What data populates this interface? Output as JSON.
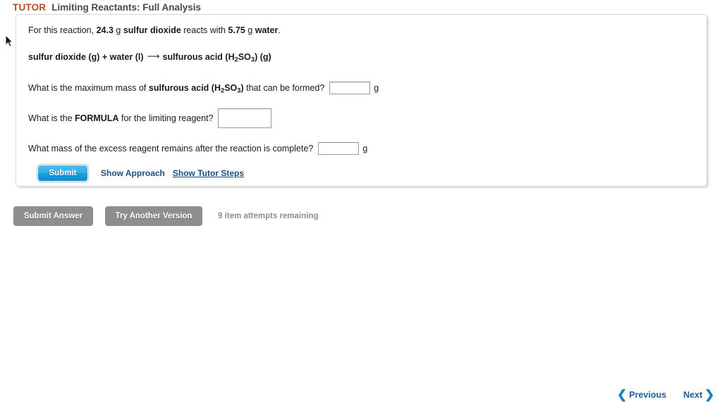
{
  "header": {
    "tutor_label": "TUTOR",
    "title": "Limiting Reactants: Full Analysis"
  },
  "question": {
    "prompt_prefix": "For this reaction, ",
    "mass_1": "24.3",
    "unit_1": " g ",
    "reactant_1": "sulfur dioxide",
    "connector": " reacts with ",
    "mass_2": "5.75",
    "unit_2": " g ",
    "reactant_2": "water",
    "period": ".",
    "equation": {
      "reactant_a": "sulfur dioxide",
      "state_a": " (g)",
      "plus": " + ",
      "reactant_b": "water",
      "state_b": " (l)",
      "arrow": "⟶",
      "product": "sulfurous acid (H",
      "product_sub1": "2",
      "product_mid": "SO",
      "product_sub2": "3",
      "product_close": ")",
      "state_c": " (g)"
    },
    "q1_pre": "What is the maximum mass of ",
    "q1_bold_a": "sulfurous acid (H",
    "q1_sub1": "2",
    "q1_bold_b": "SO",
    "q1_sub2": "3",
    "q1_bold_c": ")",
    "q1_post": " that can be formed?",
    "q1_value": "",
    "q1_unit": "g",
    "q2_pre": "What is the ",
    "q2_bold": "FORMULA",
    "q2_post": " for the limiting reagent?",
    "q2_value": "",
    "q3_text": "What mass of the excess reagent remains after the reaction is complete?",
    "q3_value": "",
    "q3_unit": "g"
  },
  "actions": {
    "submit_label": "Submit",
    "show_approach_label": "Show Approach",
    "show_tutor_steps_label": "Show Tutor Steps"
  },
  "footer": {
    "submit_answer_label": "Submit Answer",
    "try_another_label": "Try Another Version",
    "attempts_text": "9 item attempts remaining"
  },
  "nav": {
    "previous_label": "Previous",
    "next_label": "Next",
    "prev_icon": "❮",
    "next_icon": "❯"
  },
  "colors": {
    "tutor_orange": "#b5501e",
    "link_blue": "#1c4e80",
    "submit_blue": "#1a94d4",
    "gray_button": "#8e8e8e",
    "nav_blue": "#1b7fc4"
  }
}
